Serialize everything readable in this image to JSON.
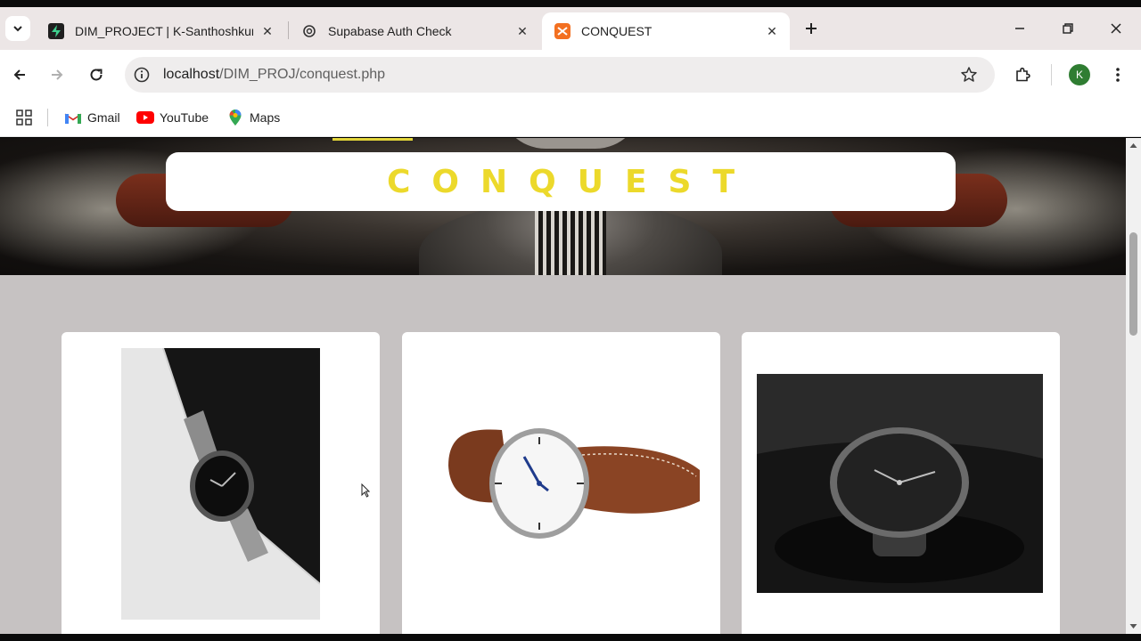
{
  "browser": {
    "tabs": [
      {
        "title": "DIM_PROJECT | K-Santhoshkum",
        "favicon": "supabase-icon",
        "active": false
      },
      {
        "title": "Supabase Auth Check",
        "favicon": "chatgpt-icon",
        "active": false
      },
      {
        "title": "CONQUEST",
        "favicon": "xampp-icon",
        "active": true
      }
    ],
    "address": {
      "host": "localhost",
      "path": "/DIM_PROJ/conquest.php"
    },
    "profile_initial": "K",
    "bookmarks": [
      {
        "label": "Gmail",
        "icon": "gmail-icon"
      },
      {
        "label": "YouTube",
        "icon": "youtube-icon"
      },
      {
        "label": "Maps",
        "icon": "maps-icon"
      }
    ]
  },
  "page": {
    "hero_title": "CONQUEST",
    "brand_color": "#ecd92b",
    "products": [
      {
        "image": "steel-bracelet-watch-on-black-white-fabric"
      },
      {
        "image": "white-dial-brown-leather-strap-watch"
      },
      {
        "image": "dark-dial-watch-on-black-surface"
      }
    ]
  }
}
